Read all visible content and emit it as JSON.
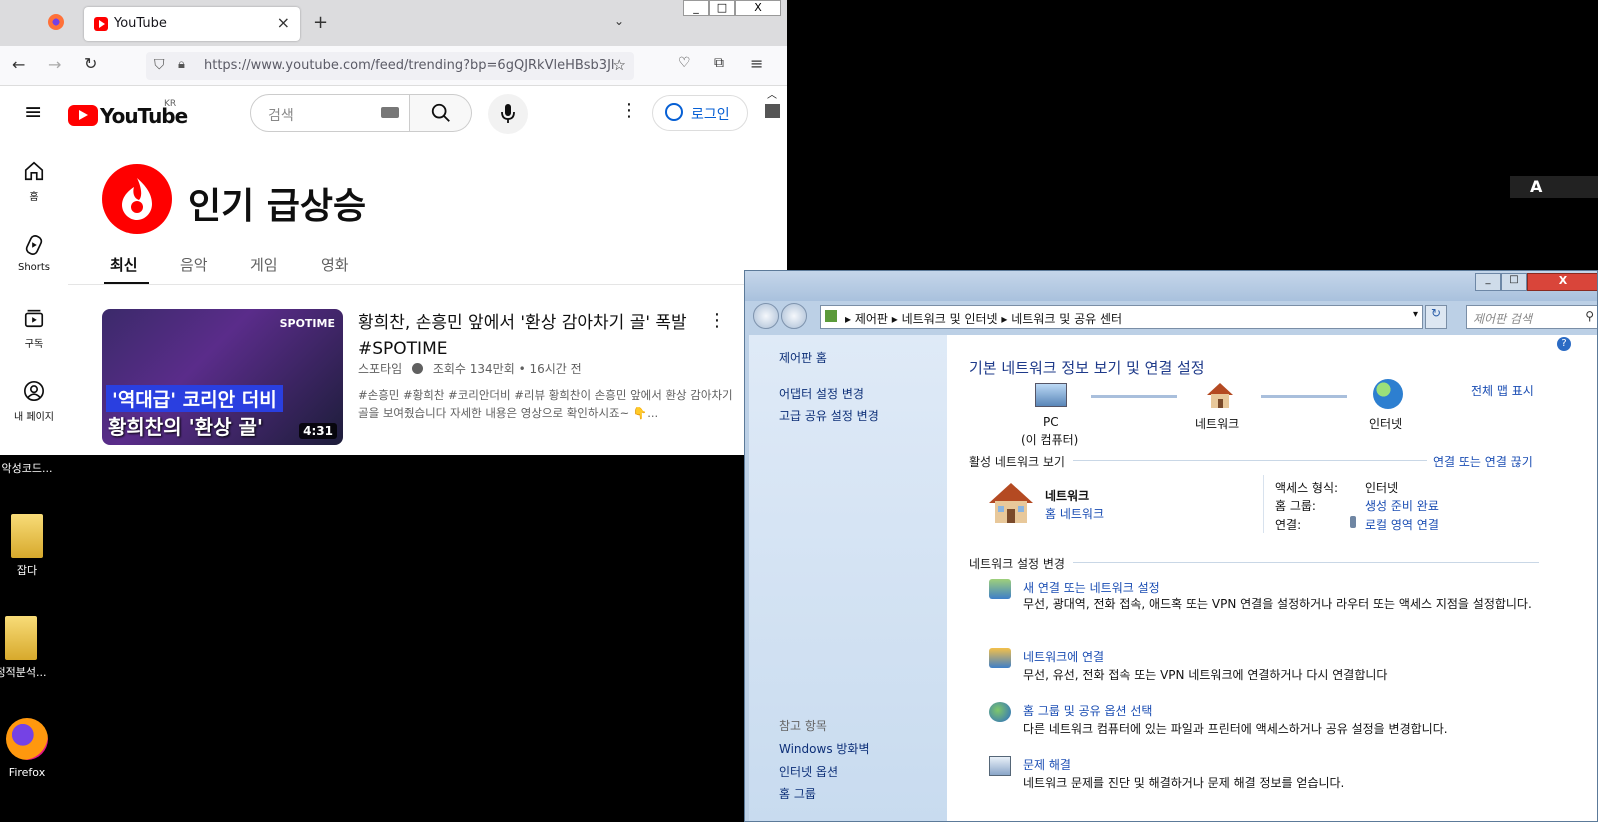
{
  "firefox": {
    "tab_title": "YouTube",
    "url": "https://www.youtube.com/feed/trending?bp=6gQJRkVleHBsb3Jl",
    "window_buttons": [
      "_",
      "□",
      "X"
    ]
  },
  "youtube": {
    "logo_text": "YouTube",
    "region": "KR",
    "search_placeholder": "검색",
    "login_label": "로그인",
    "sidebar": [
      {
        "label": "홈"
      },
      {
        "label": "Shorts"
      },
      {
        "label": "구독"
      },
      {
        "label": "내 페이지"
      }
    ],
    "page_title": "인기 급상승",
    "tabs": [
      "최신",
      "음악",
      "게임",
      "영화"
    ],
    "video": {
      "title": "황희찬, 손흥민 앞에서 '환상 감아차기 골' 폭발 #SPOTIME",
      "channel": "스포타임",
      "views": "조회수 134만회",
      "age": "16시간 전",
      "description": "#손흥민 #황희찬 #코리안더비 #리뷰 황희찬이 손흥민 앞에서 환상 감아차기 골을 보여줬습니다 자세한 내용은 영상으로 확인하시죠~ 👇...",
      "thumb_caption1": "'역대급' 코리안 더비",
      "thumb_caption2": "황희찬의 '환상 골'",
      "thumb_brand": "SPOTIME",
      "duration": "4:31"
    }
  },
  "desktop_icons": [
    {
      "label": "악성코드..."
    },
    {
      "label": "잡다"
    },
    {
      "label": "정적분석..."
    },
    {
      "label": "Firefox"
    }
  ],
  "control_panel": {
    "breadcrumb": [
      "제어판",
      "네트워크 및 인터넷",
      "네트워크 및 공유 센터"
    ],
    "search_placeholder": "제어판 검색",
    "left_links": [
      "제어판 홈",
      "어댑터 설정 변경",
      "고급 공유 설정 변경"
    ],
    "see_also_title": "참고 항목",
    "see_also": [
      "Windows 방화벽",
      "인터넷 옵션",
      "홈 그룹"
    ],
    "heading": "기본 네트워크 정보 보기 및 연결 설정",
    "full_map": "전체 맵 표시",
    "map": {
      "pc": "PC",
      "pc_sub": "(이 컴퓨터)",
      "network": "네트워크",
      "internet": "인터넷"
    },
    "active_section": "활성 네트워크 보기",
    "connect_link": "연결 또는 연결 끊기",
    "active_network": {
      "name": "네트워크",
      "type_link": "홈 네트워크",
      "access_label": "액세스 형식:",
      "access_value": "인터넷",
      "homegroup_label": "홈 그룹:",
      "homegroup_value": "생성 준비 완료",
      "conn_label": "연결:",
      "conn_value": "로컬 영역 연결"
    },
    "change_section": "네트워크 설정 변경",
    "tasks": [
      {
        "title": "새 연결 또는 네트워크 설정",
        "desc": "무선, 광대역, 전화 접속, 애드혹 또는 VPN 연결을 설정하거나 라우터 또는 액세스 지점을 설정합니다."
      },
      {
        "title": "네트워크에 연결",
        "desc": "무선, 유선, 전화 접속 또는 VPN 네트워크에 연결하거나 다시 연결합니다"
      },
      {
        "title": "홈 그룹 및 공유 옵션 선택",
        "desc": "다른 네트워크 컴퓨터에 있는 파일과 프린터에 액세스하거나 공유 설정을 변경합니다."
      },
      {
        "title": "문제 해결",
        "desc": "네트워크 문제를 진단 및 해결하거나 문제 해결 정보를 얻습니다."
      }
    ]
  },
  "tray_text": "A"
}
